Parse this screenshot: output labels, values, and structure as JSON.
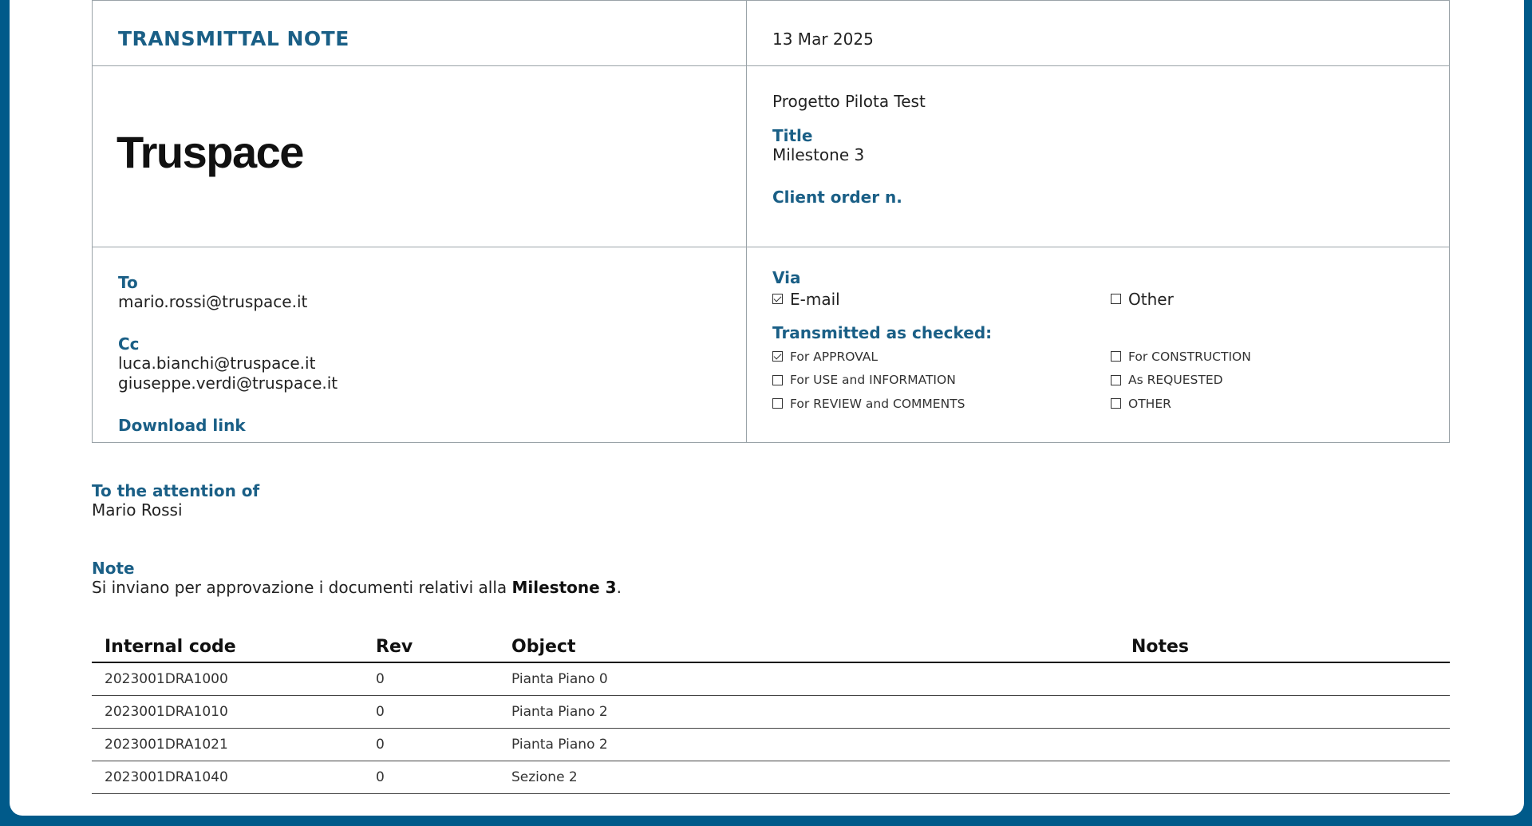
{
  "header": {
    "title": "TRANSMITTAL NOTE",
    "date": "13 Mar 2025",
    "logo": "Truspace",
    "project": "Progetto Pilota Test",
    "title_label": "Title",
    "title_value": "Milestone 3",
    "client_order_label": "Client order n."
  },
  "recipients": {
    "to_label": "To",
    "to": "mario.rossi@truspace.it",
    "cc_label": "Cc",
    "cc": [
      "luca.bianchi@truspace.it",
      "giuseppe.verdi@truspace.it"
    ],
    "download_label": "Download link"
  },
  "via": {
    "label": "Via",
    "options": [
      {
        "label": "E-mail",
        "checked": true
      },
      {
        "label": "Other",
        "checked": false
      }
    ]
  },
  "transmitted": {
    "label": "Transmitted as checked:",
    "options": [
      {
        "label": "For APPROVAL",
        "checked": true
      },
      {
        "label": "For CONSTRUCTION",
        "checked": false
      },
      {
        "label": "For USE and INFORMATION",
        "checked": false
      },
      {
        "label": "As REQUESTED",
        "checked": false
      },
      {
        "label": "For REVIEW and COMMENTS",
        "checked": false
      },
      {
        "label": "OTHER",
        "checked": false
      }
    ]
  },
  "attention": {
    "label": "To the attention of",
    "value": "Mario Rossi"
  },
  "note": {
    "label": "Note",
    "text_before": "Si inviano per approvazione i documenti relativi alla ",
    "text_bold": "Milestone 3",
    "text_after": "."
  },
  "table": {
    "headers": [
      "Internal code",
      "Rev",
      "Object",
      "Notes"
    ],
    "rows": [
      {
        "code": "2023001DRA1000",
        "rev": "0",
        "object": "Pianta Piano 0",
        "notes": ""
      },
      {
        "code": "2023001DRA1010",
        "rev": "0",
        "object": "Pianta Piano 2",
        "notes": ""
      },
      {
        "code": "2023001DRA1021",
        "rev": "0",
        "object": "Pianta Piano 2",
        "notes": ""
      },
      {
        "code": "2023001DRA1040",
        "rev": "0",
        "object": "Sezione 2",
        "notes": ""
      }
    ]
  }
}
